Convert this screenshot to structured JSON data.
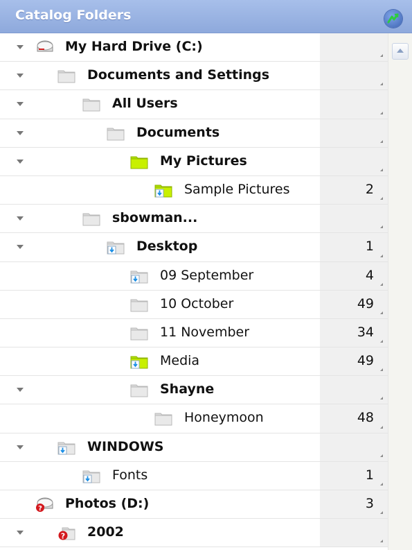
{
  "header": {
    "title": "Catalog Folders",
    "menu_icon": "panel-menu-icon"
  },
  "colors": {
    "header": "#98b2e3",
    "count_column": "#f0f0f0",
    "folder": "#e9e9e9",
    "folder_linked": "#c8f000",
    "sync_arrow": "#1b8fe6",
    "offline_badge": "#d3181d"
  },
  "rows": [
    {
      "label": "My Hard Drive (C:)",
      "count": "",
      "bold": true,
      "icon": "hard-drive-icon",
      "expand": true,
      "indent": 0
    },
    {
      "label": "Documents and Settings",
      "count": "",
      "bold": true,
      "icon": "folder-icon",
      "expand": true,
      "indent": 1
    },
    {
      "label": "All Users",
      "count": "",
      "bold": true,
      "icon": "folder-icon",
      "expand": true,
      "indent": 2
    },
    {
      "label": "Documents",
      "count": "",
      "bold": true,
      "icon": "folder-icon",
      "expand": true,
      "indent": 3
    },
    {
      "label": "My Pictures",
      "count": "",
      "bold": true,
      "icon": "green-folder-icon",
      "expand": true,
      "indent": 4
    },
    {
      "label": "Sample Pictures",
      "count": "2",
      "bold": false,
      "icon": "green-sync-folder-icon",
      "expand": false,
      "indent": 5
    },
    {
      "label": "sbowman...",
      "count": "",
      "bold": true,
      "icon": "folder-icon",
      "expand": true,
      "indent": 2
    },
    {
      "label": "Desktop",
      "count": "1",
      "bold": true,
      "icon": "sync-folder-icon",
      "expand": true,
      "indent": 3
    },
    {
      "label": "09 September",
      "count": "4",
      "bold": false,
      "icon": "sync-folder-icon",
      "expand": false,
      "indent": 4
    },
    {
      "label": "10 October",
      "count": "49",
      "bold": false,
      "icon": "folder-icon",
      "expand": false,
      "indent": 4
    },
    {
      "label": "11 November",
      "count": "34",
      "bold": false,
      "icon": "folder-icon",
      "expand": false,
      "indent": 4
    },
    {
      "label": "Media",
      "count": "49",
      "bold": false,
      "icon": "green-sync-folder-icon",
      "expand": false,
      "indent": 4
    },
    {
      "label": "Shayne",
      "count": "",
      "bold": true,
      "icon": "folder-icon",
      "expand": true,
      "indent": 4
    },
    {
      "label": "Honeymoon",
      "count": "48",
      "bold": false,
      "icon": "folder-icon",
      "expand": false,
      "indent": 5
    },
    {
      "label": "WINDOWS",
      "count": "",
      "bold": true,
      "icon": "sync-folder-icon",
      "expand": true,
      "indent": 1
    },
    {
      "label": "Fonts",
      "count": "1",
      "bold": false,
      "icon": "sync-folder-icon",
      "expand": false,
      "indent": 2
    },
    {
      "label": "Photos (D:)",
      "count": "3",
      "bold": true,
      "icon": "offline-drive-icon",
      "expand": false,
      "indent": 0
    },
    {
      "label": "2002",
      "count": "",
      "bold": true,
      "icon": "offline-folder-icon",
      "expand": true,
      "indent": 1
    }
  ]
}
